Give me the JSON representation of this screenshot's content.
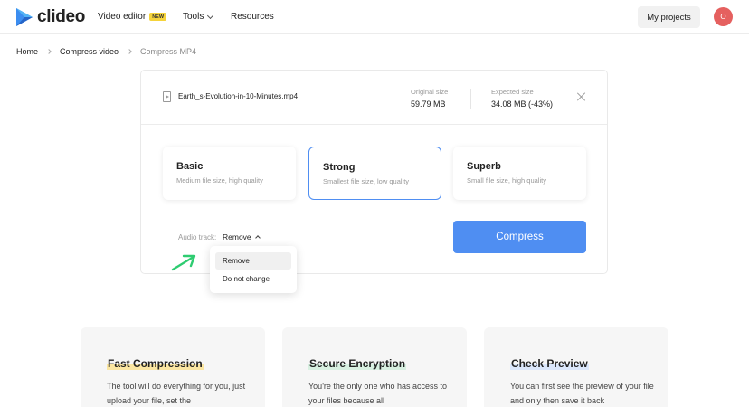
{
  "header": {
    "logo_text": "clideo",
    "nav": {
      "video_editor": "Video editor",
      "new_badge": "NEW",
      "tools": "Tools",
      "resources": "Resources"
    },
    "my_projects": "My projects",
    "avatar_initial": "O"
  },
  "breadcrumb": [
    "Home",
    "Compress video",
    "Compress MP4"
  ],
  "file": {
    "name": "Earth_s-Evolution-in-10-Minutes.mp4",
    "original_label": "Original size",
    "original_value": "59.79 MB",
    "expected_label": "Expected size",
    "expected_value": "34.08 MB (-43%)"
  },
  "options": [
    {
      "title": "Basic",
      "subtitle": "Medium file size, high quality"
    },
    {
      "title": "Strong",
      "subtitle": "Smallest file size, low quality"
    },
    {
      "title": "Superb",
      "subtitle": "Small file size, high quality"
    }
  ],
  "selected_option": "Strong",
  "audio": {
    "label": "Audio track:",
    "value": "Remove",
    "options": [
      "Remove",
      "Do not change"
    ]
  },
  "compress_button": "Compress",
  "features": [
    {
      "title": "Fast Compression",
      "text": "The tool will do everything for you, just upload your file, set the"
    },
    {
      "title": "Secure Encryption",
      "text": "You're the only one who has access to your files because all"
    },
    {
      "title": "Check Preview",
      "text": "You can first see the preview of your file and only then save it back"
    }
  ],
  "colors": {
    "accent": "#4f8ef2",
    "avatar": "#e5605f",
    "new_badge": "#f5d33a",
    "annotation_arrow": "#2ecc71"
  }
}
